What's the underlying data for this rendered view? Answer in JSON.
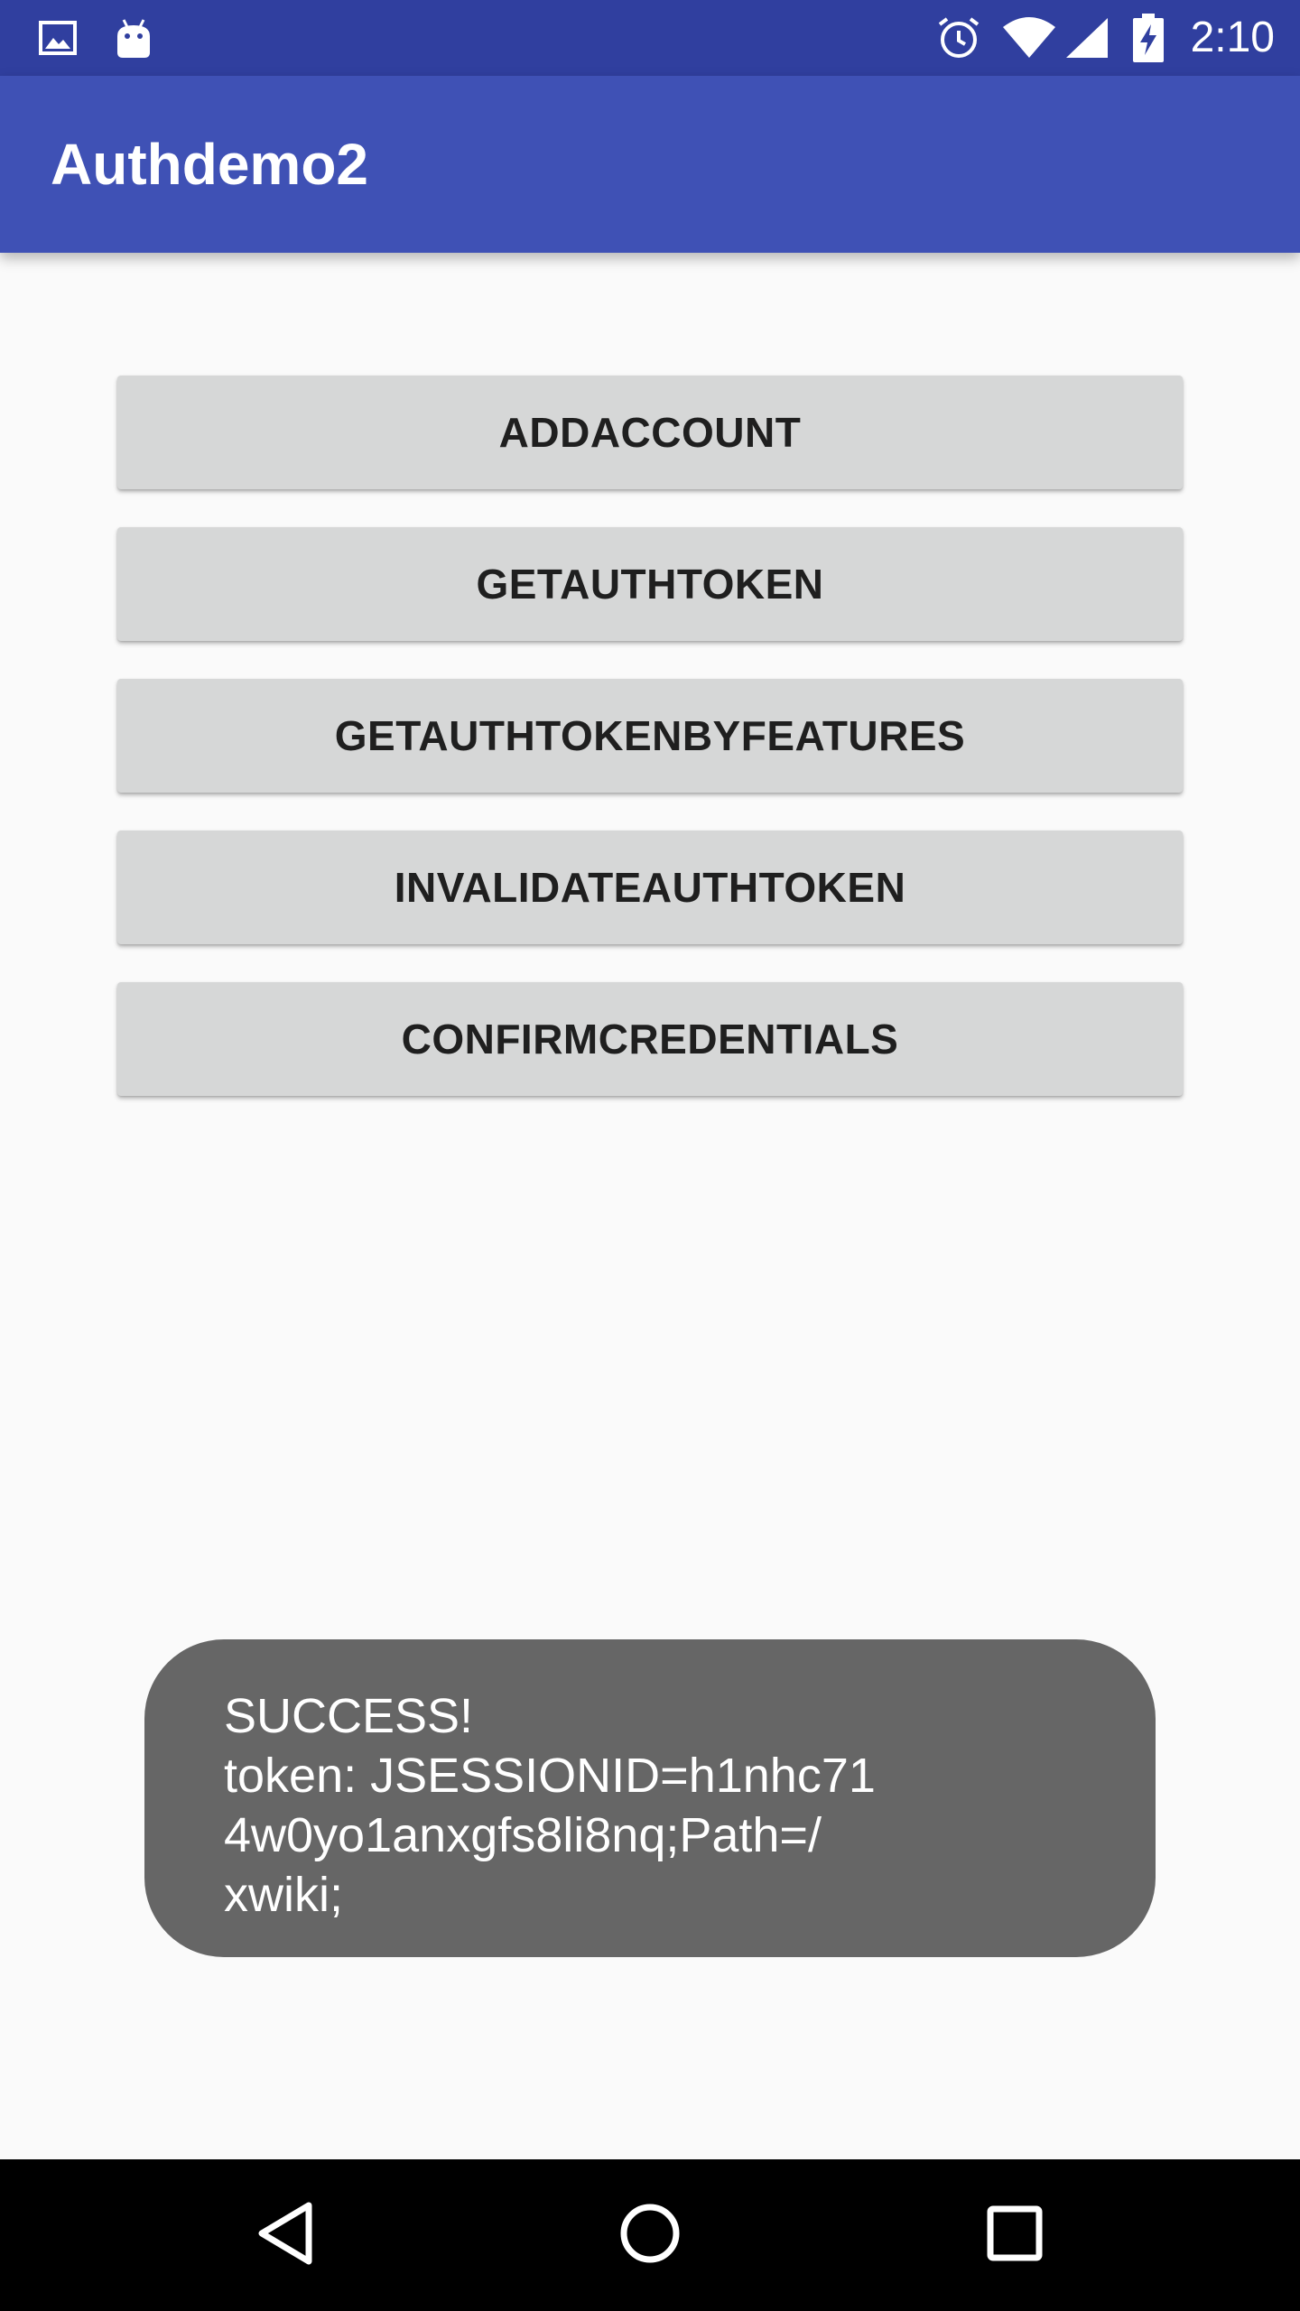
{
  "status_bar": {
    "time": "2:10",
    "left_icons": [
      "image-icon",
      "android-icon"
    ],
    "right_icons": [
      "alarm-icon",
      "wifi-icon",
      "signal-icon",
      "battery-charging-icon"
    ]
  },
  "app_bar": {
    "title": "Authdemo2"
  },
  "buttons": [
    {
      "label": "ADDACCOUNT"
    },
    {
      "label": "GETAUTHTOKEN"
    },
    {
      "label": "GETAUTHTOKENBYFEATURES"
    },
    {
      "label": "INVALIDATEAUTHTOKEN"
    },
    {
      "label": "CONFIRMCREDENTIALS"
    }
  ],
  "toast": {
    "lines": [
      "SUCCESS!",
      "token: JSESSIONID=h1nhc71",
      "4w0yo1anxgfs8li8nq;Path=/",
      "xwiki;"
    ]
  },
  "nav_bar": {
    "buttons": [
      "back-icon",
      "home-icon",
      "recents-icon"
    ]
  },
  "colors": {
    "status_bar": "#303f9f",
    "app_bar": "#3f51b5",
    "background": "#fafafa",
    "button": "#d6d7d7",
    "toast": "#666666",
    "nav_bar": "#000000"
  }
}
